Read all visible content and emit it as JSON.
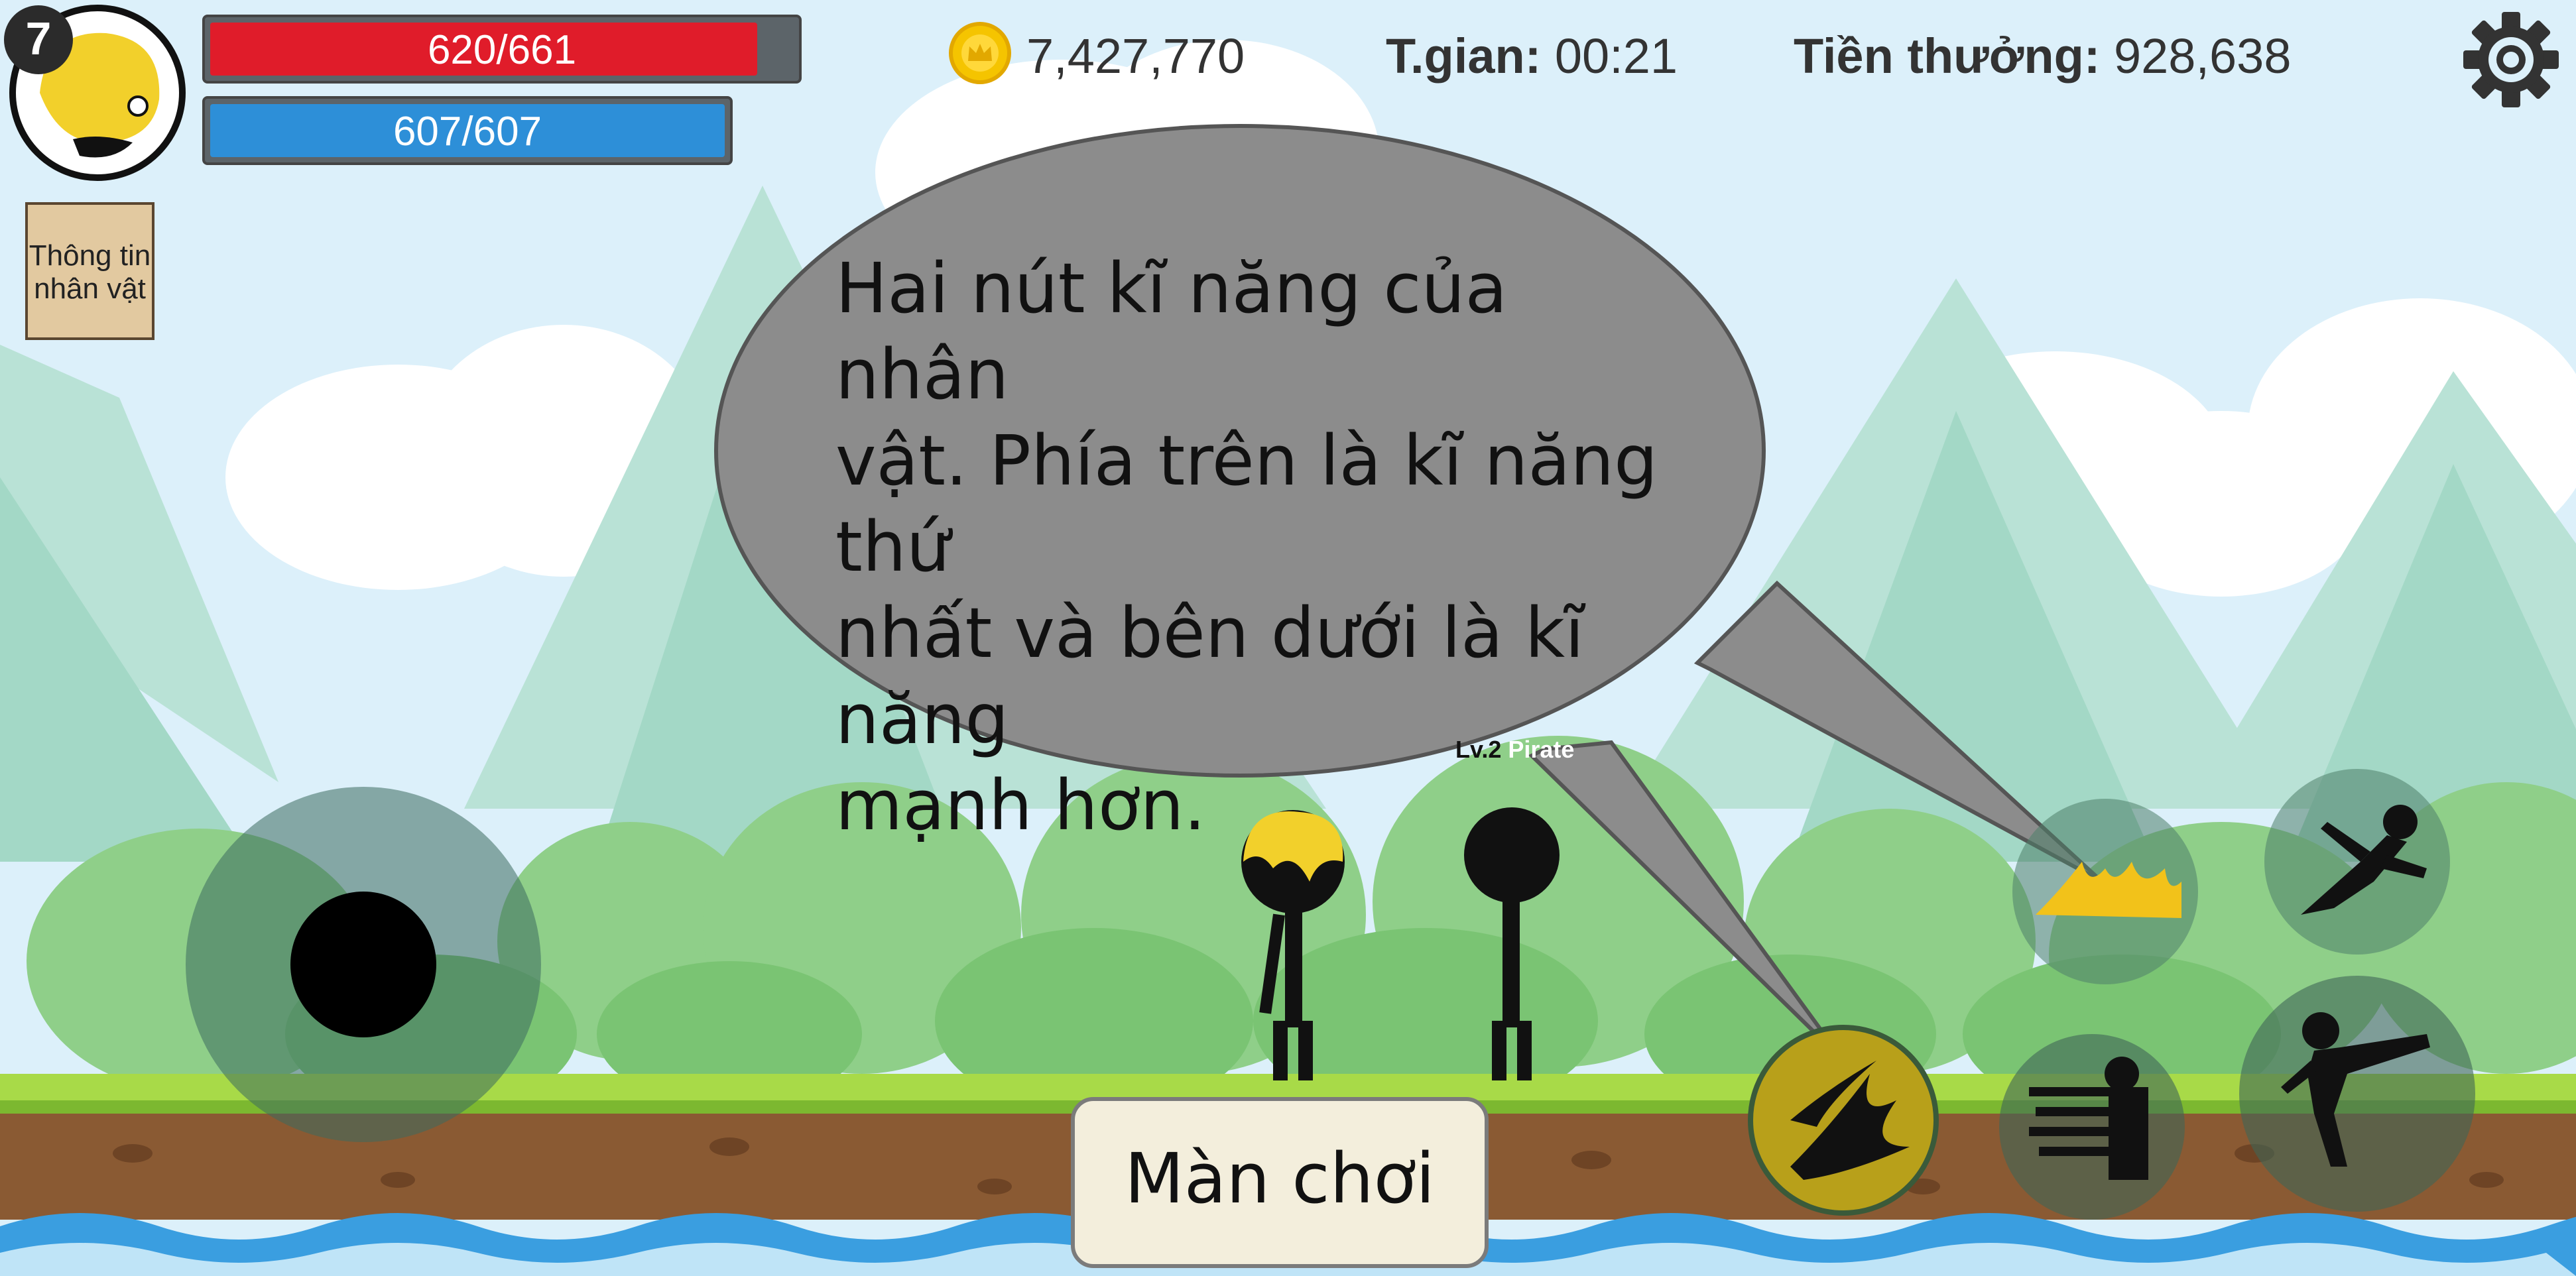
{
  "player": {
    "level": "7",
    "hp_text": "620/661",
    "hp_fraction": 0.938,
    "mp_text": "607/607",
    "mp_fraction": 1.0
  },
  "character_info_button": {
    "line1": "Thông tin",
    "line2": "nhân vật"
  },
  "hud": {
    "coins": "7,427,770",
    "time_label": "T.gian:",
    "time_value": "00:21",
    "reward_label": "Tiền thưởng:",
    "reward_value": "928,638"
  },
  "tutorial": {
    "line1": "Hai nút kĩ năng của nhân",
    "line2": "vật. Phía trên là kĩ năng thứ",
    "line3": "nhất và bên dưới là kĩ năng",
    "line4": "mạnh hơn."
  },
  "enemy": {
    "level_label": "Lv.2",
    "name": "Pirate"
  },
  "level_button": {
    "label": "Màn chơi"
  },
  "icons": {
    "settings": "gear-icon",
    "coin": "coin-icon",
    "skill1": "golden-flame-icon",
    "skill2": "fire-burst-icon",
    "dash": "dash-kick-icon",
    "combo": "multi-punch-icon",
    "kick": "high-kick-icon"
  },
  "colors": {
    "hp": "#e01c2a",
    "mp": "#2d8fd8",
    "bubble": "#8c8c8c",
    "grass": "#9bd23a",
    "dirt": "#8a5a33",
    "water": "#3a9ee0"
  }
}
